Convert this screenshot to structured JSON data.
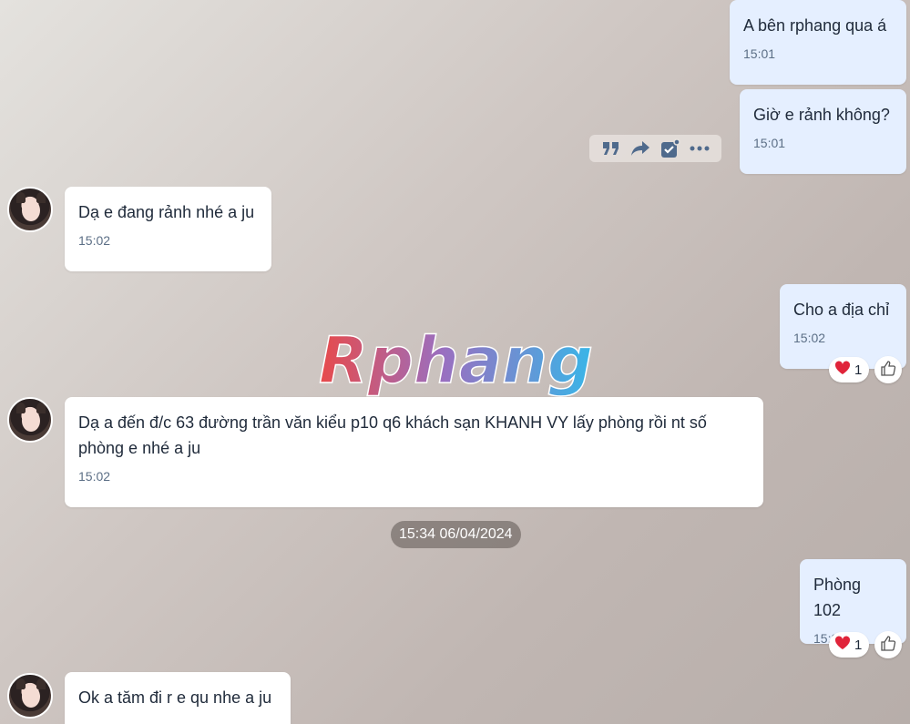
{
  "messages": [
    {
      "text": "A bên rphang qua á",
      "time": "15:01"
    },
    {
      "text": "Giờ e rảnh không?",
      "time": "15:01"
    },
    {
      "text": "Dạ e đang rảnh nhé a ju",
      "time": "15:02"
    },
    {
      "text": "Cho a địa chỉ",
      "time": "15:02"
    },
    {
      "text": "Dạ a đến đ/c 63 đường trần văn kiểu p10 q6 khách sạn KHANH VY lấy phòng rồi nt số\nphòng e nhé a ju",
      "time": "15:02"
    },
    {
      "text": "Phòng 102",
      "time": "15:34"
    },
    {
      "text": "Ok a tăm đi r e qu nhe a ju",
      "time": ""
    }
  ],
  "date_separator": "15:34 06/04/2024",
  "reactions": [
    {
      "emoji": "heart",
      "count": "1"
    },
    {
      "emoji": "heart",
      "count": "1"
    }
  ],
  "watermark": "Rphang",
  "toolbar": {
    "icons": [
      "quote-icon",
      "forward-icon",
      "task-icon",
      "more-icon"
    ]
  },
  "colors": {
    "outgoing_bubble": "#e5efff",
    "incoming_bubble": "#ffffff",
    "time_text": "#5c6f86",
    "heart": "#e0243a"
  }
}
